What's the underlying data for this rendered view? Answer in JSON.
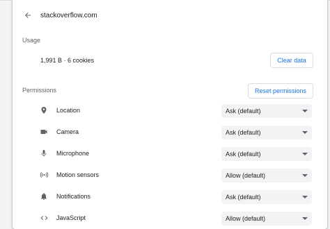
{
  "header": {
    "site": "stackoverflow.com"
  },
  "usage": {
    "section_label": "Usage",
    "summary": "1,991 B · 6 cookies",
    "clear_label": "Clear data"
  },
  "permissions": {
    "section_label": "Permissions",
    "reset_label": "Reset permissions",
    "items": [
      {
        "name": "Location",
        "value": "Ask (default)",
        "icon": "location-pin-icon"
      },
      {
        "name": "Camera",
        "value": "Ask (default)",
        "icon": "camera-icon"
      },
      {
        "name": "Microphone",
        "value": "Ask (default)",
        "icon": "microphone-icon"
      },
      {
        "name": "Motion sensors",
        "value": "Allow (default)",
        "icon": "motion-sensors-icon"
      },
      {
        "name": "Notifications",
        "value": "Ask (default)",
        "icon": "bell-icon"
      },
      {
        "name": "JavaScript",
        "value": "Allow (default)",
        "icon": "code-icon"
      }
    ]
  },
  "colors": {
    "accent": "#1a73e8",
    "select_bg": "#f1f3f4",
    "text": "#202124",
    "muted": "#5f6368"
  }
}
